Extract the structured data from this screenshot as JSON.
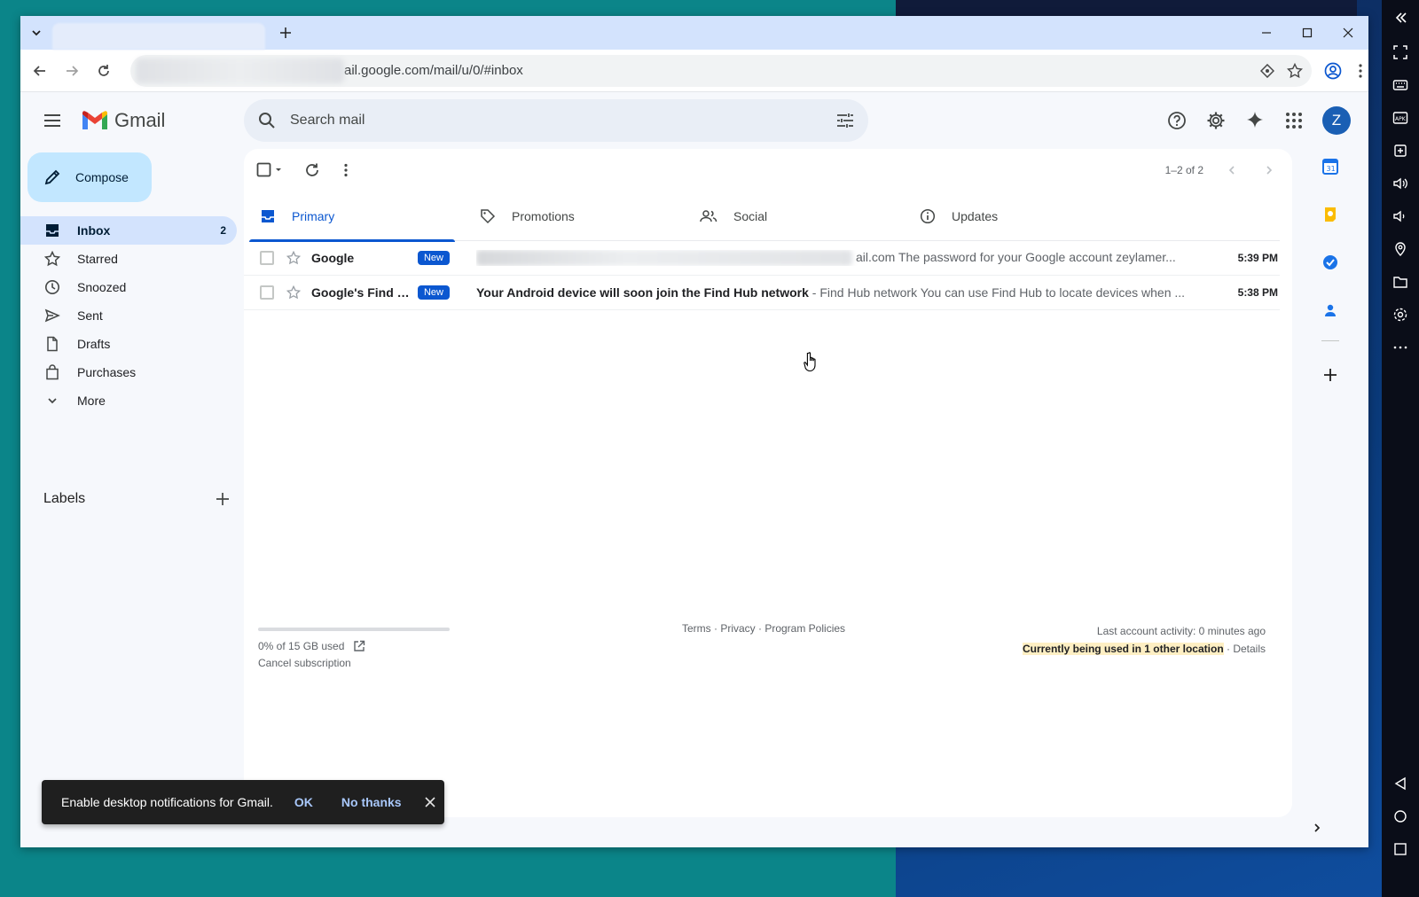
{
  "browser": {
    "url_visible": "ail.google.com/mail/u/0/#inbox"
  },
  "gmail": {
    "logo_text": "Gmail",
    "search_placeholder": "Search mail",
    "avatar_letter": "Z",
    "compose_label": "Compose",
    "nav": [
      {
        "label": "Inbox",
        "count": "2",
        "icon": "inbox-icon"
      },
      {
        "label": "Starred",
        "icon": "star-icon"
      },
      {
        "label": "Snoozed",
        "icon": "clock-icon"
      },
      {
        "label": "Sent",
        "icon": "send-icon"
      },
      {
        "label": "Drafts",
        "icon": "file-icon"
      },
      {
        "label": "Purchases",
        "icon": "bag-icon"
      },
      {
        "label": "More",
        "icon": "chevron-down-icon"
      }
    ],
    "labels_title": "Labels",
    "pager_text": "1–2 of 2",
    "tabs": [
      {
        "label": "Primary",
        "icon": "inbox-icon"
      },
      {
        "label": "Promotions",
        "icon": "tag-icon"
      },
      {
        "label": "Social",
        "icon": "people-icon"
      },
      {
        "label": "Updates",
        "icon": "info-icon"
      }
    ],
    "emails": [
      {
        "sender": "Google",
        "badge": "New",
        "subject": "",
        "snippet": "ail.com The password for your Google account zeylamer...",
        "time": "5:39 PM"
      },
      {
        "sender": "Google's Find Hub",
        "badge": "New",
        "subject": "Your Android device will soon join the Find Hub network",
        "snippet": " - Find Hub network You can use Find Hub to locate devices when ...",
        "time": "5:38 PM"
      }
    ],
    "footer": {
      "storage": "0% of 15 GB used",
      "storage_percent": 0,
      "cancel": "Cancel subscription",
      "links": "Terms · Privacy · Program Policies",
      "activity": "Last account activity: 0 minutes ago",
      "other_location": "Currently being used in 1 other location",
      "details": " · Details"
    }
  },
  "snackbar": {
    "text": "Enable desktop notifications for Gmail.",
    "ok": "OK",
    "no_thanks": "No thanks"
  },
  "colors": {
    "accent": "#0b57d0",
    "compose_bg": "#c2e7ff",
    "inbox_active_bg": "#d3e3fd",
    "desktop_bg": "#0b8589"
  }
}
